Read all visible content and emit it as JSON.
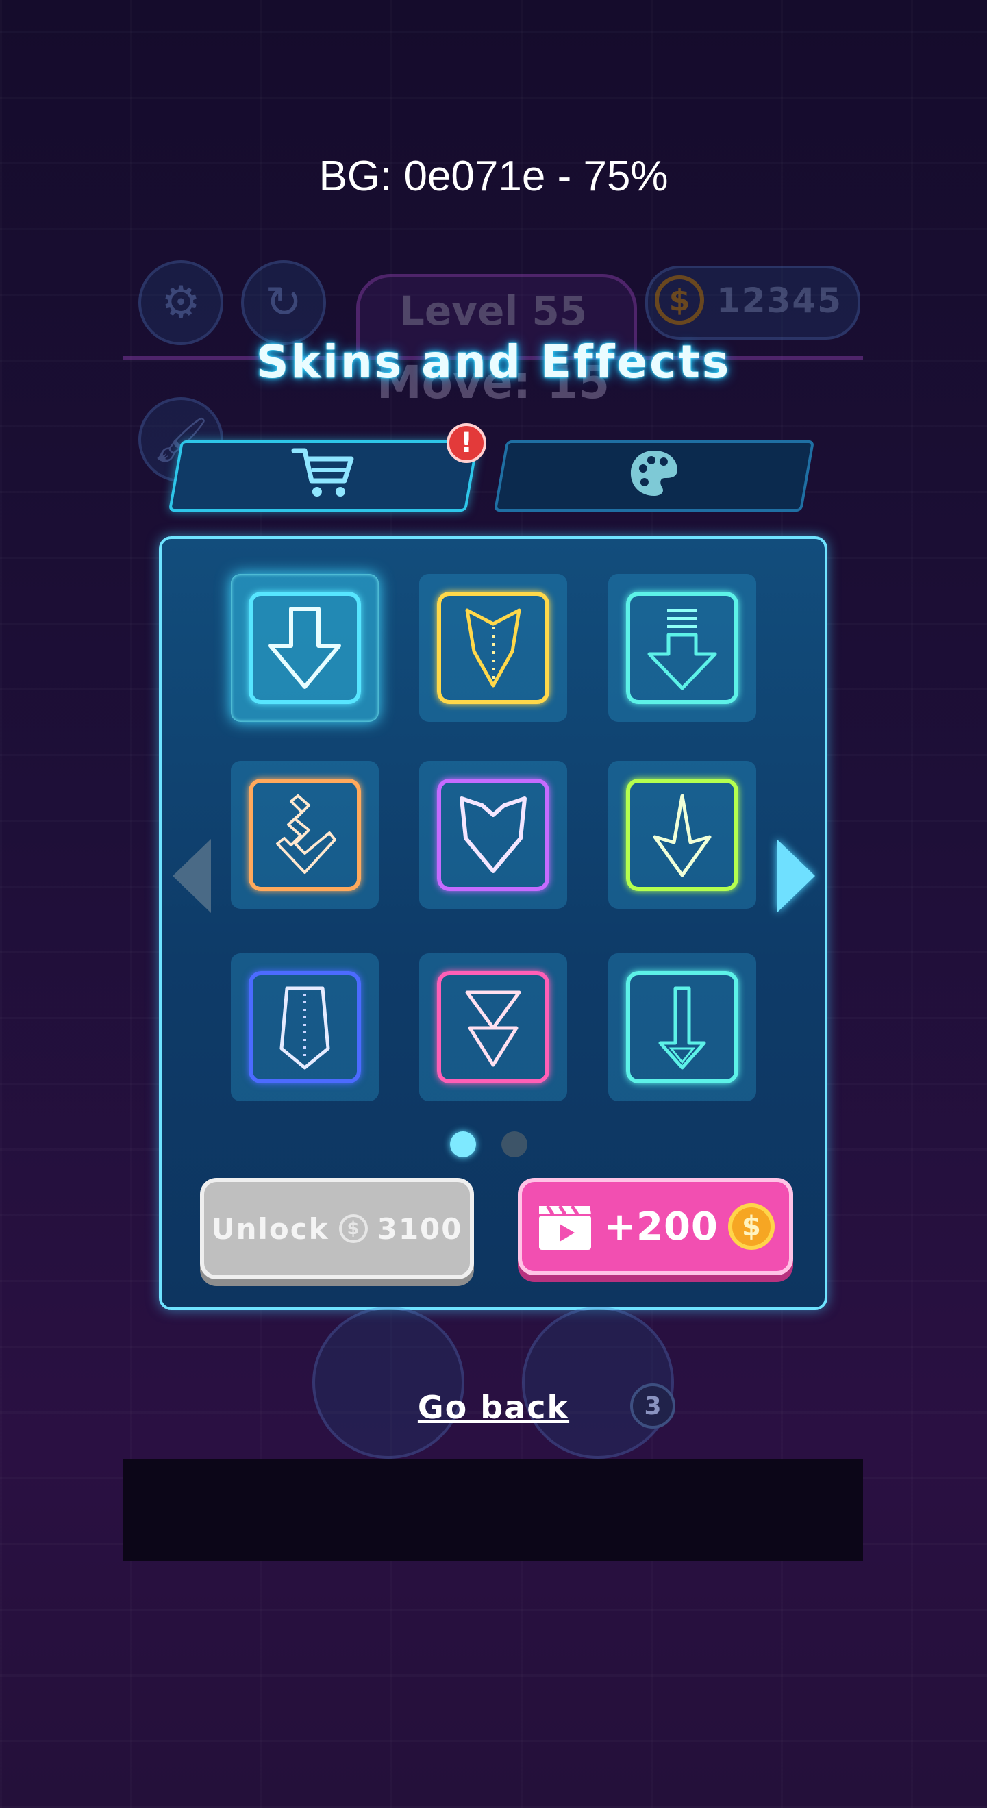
{
  "debug": {
    "caption": "BG: 0e071e  - 75%"
  },
  "hud": {
    "settings_icon": "gear-icon",
    "restart_icon": "restart-icon",
    "brush_icon": "brush-icon",
    "level_label": "Level 55",
    "move_label": "Move: 15",
    "coins": "12345"
  },
  "modal": {
    "title": "Skins and Effects",
    "tabs": [
      {
        "id": "shop",
        "icon": "cart-icon",
        "active": true,
        "badge": "!"
      },
      {
        "id": "palette",
        "icon": "palette-icon",
        "active": false
      }
    ],
    "skins": [
      {
        "name": "skin-classic-arrow",
        "color": "#57e6ff",
        "selected": true
      },
      {
        "name": "skin-yellow-chevron-arrow",
        "color": "#ffd84a",
        "selected": false
      },
      {
        "name": "skin-striped-arrow",
        "color": "#5df2e8",
        "selected": false
      },
      {
        "name": "skin-zigzag-arrow",
        "color": "#ffa95c",
        "selected": false
      },
      {
        "name": "skin-shield-arrow",
        "color": "#c56bff",
        "selected": false
      },
      {
        "name": "skin-spike-arrow",
        "color": "#b4ff4f",
        "selected": false
      },
      {
        "name": "skin-tie-arrow",
        "color": "#4c6bff",
        "selected": false
      },
      {
        "name": "skin-lightning-arrow",
        "color": "#ff5fb6",
        "selected": false
      },
      {
        "name": "skin-long-arrow",
        "color": "#5df2e8",
        "selected": false
      }
    ],
    "pagination": {
      "page": 1,
      "pages": 2
    },
    "unlock_label": "Unlock",
    "unlock_price": "3100",
    "reward_label": "+200",
    "go_back": "Go back",
    "hammer_count": "3"
  },
  "colors": {
    "background": "#0e071e",
    "accent_cyan": "#6fe3ff",
    "reward_pink": "#f24fb1"
  }
}
